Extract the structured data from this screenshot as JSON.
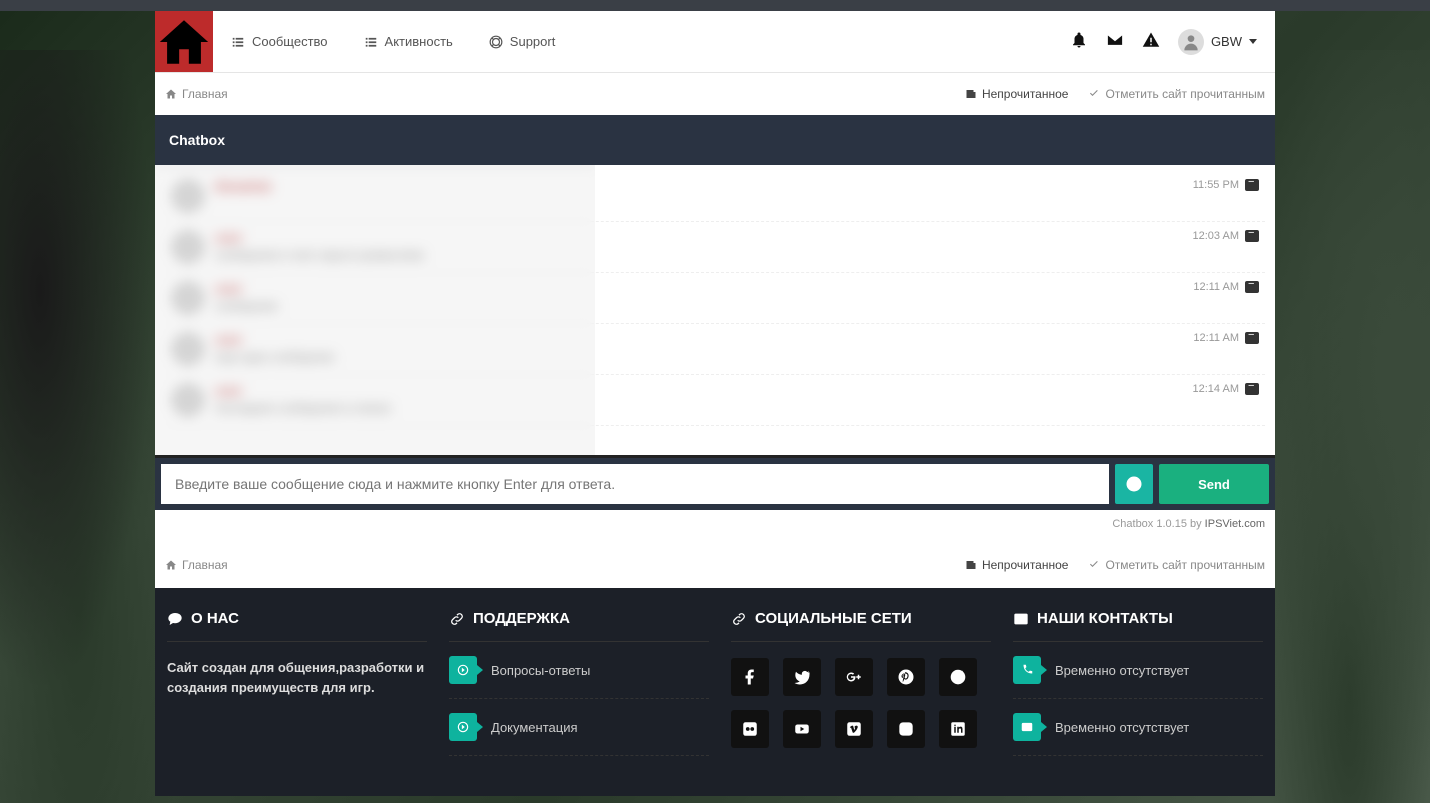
{
  "nav": {
    "items": [
      {
        "label": "Сообщество"
      },
      {
        "label": "Активность"
      },
      {
        "label": "Support"
      }
    ]
  },
  "user": {
    "name": "GBW"
  },
  "breadcrumb": {
    "home": "Главная",
    "unread": "Непрочитанное",
    "mark_read": "Отметить сайт прочитанным"
  },
  "chatbox": {
    "title": "Chatbox",
    "messages": [
      {
        "name": "DimaHok",
        "text": " ",
        "time": "11:55 PM"
      },
      {
        "name": "user",
        "text": "сообщение в чате скрыто размытием",
        "time": "12:03 AM"
      },
      {
        "name": "user",
        "text": "сообщение",
        "time": "12:11 AM"
      },
      {
        "name": "user",
        "text": "еще одно сообщение",
        "time": "12:11 AM"
      },
      {
        "name": "user",
        "text": "последнее сообщение в списке",
        "time": "12:14 AM"
      }
    ],
    "input_placeholder": "Введите ваше сообщение сюда и нажмите кнопку Enter для ответа.",
    "send_label": "Send",
    "credit_prefix": "Chatbox 1.0.15 by ",
    "credit_link": "IPSViet.com"
  },
  "footer": {
    "about": {
      "title": "О НАС",
      "body": "Сайт создан для общения,разработки и создания преимуществ для игр."
    },
    "support": {
      "title": "ПОДДЕРЖКА",
      "links": [
        {
          "label": "Вопросы-ответы"
        },
        {
          "label": "Документация"
        }
      ]
    },
    "social": {
      "title": "СОЦИАЛЬНЫЕ СЕТИ"
    },
    "contacts": {
      "title": "НАШИ КОНТАКТЫ",
      "items": [
        {
          "label": "Временно отсутствует"
        },
        {
          "label": "Временно отсутствует"
        }
      ]
    }
  }
}
